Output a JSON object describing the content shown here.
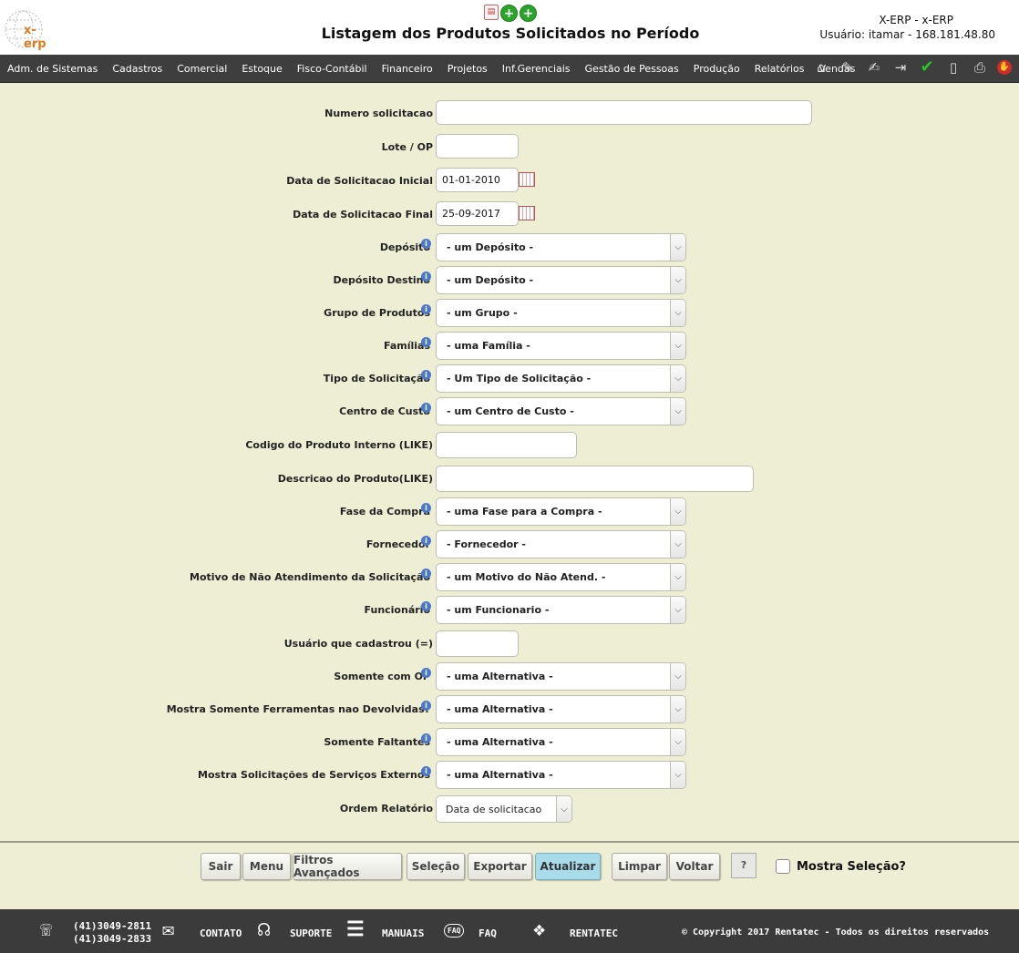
{
  "header": {
    "logo_text": "x-erp",
    "title": "Listagem dos Produtos Solicitados no Período",
    "system_name": "X-ERP - x-ERP",
    "user_info": "Usuário: itamar - 168.181.48.80",
    "top_icons": [
      "pdf-icon",
      "add-icon",
      "add-icon"
    ]
  },
  "menu": {
    "items": [
      "Adm. de Sistemas",
      "Cadastros",
      "Comercial",
      "Estoque",
      "Fisco-Contábil",
      "Financeiro",
      "Projetos",
      "Inf.Gerenciais",
      "Gestão de Pessoas",
      "Produção",
      "Relatórios",
      "Vendas"
    ],
    "icons": [
      "home-icon",
      "edit-icon",
      "document-edit-icon",
      "exit-icon",
      "check-icon",
      "page-icon",
      "print-icon",
      "stop-icon"
    ]
  },
  "form": {
    "numero_solicitacao": {
      "label": "Numero solicitacao",
      "value": ""
    },
    "lote_op": {
      "label": "Lote / OP",
      "value": ""
    },
    "data_inicial": {
      "label": "Data de Solicitacao Inicial",
      "value": "01-01-2010"
    },
    "data_final": {
      "label": "Data de Solicitacao Final",
      "value": "25-09-2017"
    },
    "deposito": {
      "label": "Depósito",
      "value": "- um Depósito -"
    },
    "deposito_destino": {
      "label": "Depósito Destino",
      "value": "- um Depósito -"
    },
    "grupo_produtos": {
      "label": "Grupo de Produtos",
      "value": "- um Grupo -"
    },
    "familias": {
      "label": "Famílias",
      "value": "- uma Família -"
    },
    "tipo_solicitacao": {
      "label": "Tipo de Solicitação",
      "value": "- Um Tipo de Solicitação -"
    },
    "centro_custo": {
      "label": "Centro de Custo",
      "value": "- um Centro de Custo -"
    },
    "codigo_produto": {
      "label": "Codigo do Produto Interno (LIKE)",
      "value": ""
    },
    "descricao_produto": {
      "label": "Descricao do Produto(LIKE)",
      "value": ""
    },
    "fase_compra": {
      "label": "Fase da Compra",
      "value": "- uma Fase para a Compra -"
    },
    "fornecedor": {
      "label": "Fornecedor",
      "value": "- Fornecedor -"
    },
    "motivo_nao_atendimento": {
      "label": "Motivo de Não Atendimento da Solicitação",
      "value": "- um Motivo do Não Atend. -"
    },
    "funcionario": {
      "label": "Funcionário",
      "value": "- um Funcionario -"
    },
    "usuario_cadastrou": {
      "label": "Usuário que cadastrou (=)",
      "value": ""
    },
    "somente_com_op": {
      "label": "Somente com OP",
      "value": "- uma Alternativa -"
    },
    "ferramentas_nao_devolvidas": {
      "label": "Mostra Somente Ferramentas nao Devolvidas?",
      "value": "- uma Alternativa -"
    },
    "somente_faltantes": {
      "label": "Somente Faltantes",
      "value": "- uma Alternativa -"
    },
    "servicos_externos": {
      "label": "Mostra Solicitações de Serviços Externos",
      "value": "- uma Alternativa -"
    },
    "ordem_relatorio": {
      "label": "Ordem Relatório",
      "value": "Data de solicitacao"
    }
  },
  "buttons": {
    "sair": "Sair",
    "menu": "Menu",
    "filtros_avancados": "Filtros Avançados",
    "selecao": "Seleção",
    "exportar": "Exportar",
    "atualizar": "Atualizar",
    "limpar": "Limpar",
    "voltar": "Voltar",
    "help": "?",
    "mostra_selecao": "Mostra Seleção?"
  },
  "footer": {
    "phone1": "(41)3049-2811",
    "phone2": "(41)3049-2833",
    "contato": "CONTATO",
    "suporte": "SUPORTE",
    "manuais": "MANUAIS",
    "faq": "FAQ",
    "faq_icon_text": "FAQ",
    "rentatec": "RENTATEC",
    "copyright": "© Copyright 2017 Rentatec - Todos os direitos reservados"
  }
}
